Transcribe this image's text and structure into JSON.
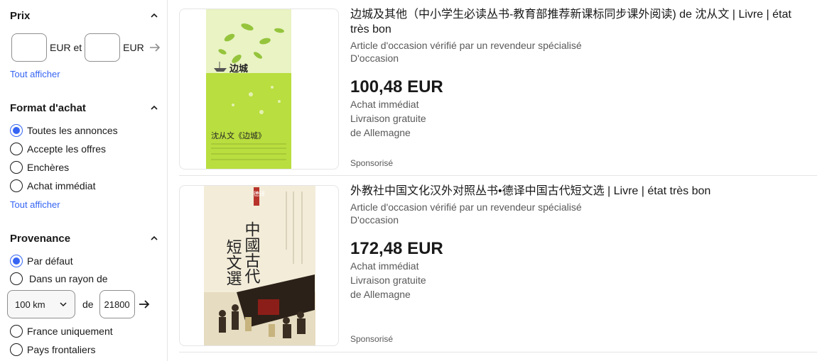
{
  "sidebar": {
    "price": {
      "title": "Prix",
      "currency_min": "EUR et",
      "currency_max": "EUR",
      "show_all": "Tout afficher"
    },
    "format": {
      "title": "Format d'achat",
      "options": [
        "Toutes les annonces",
        "Accepte les offres",
        "Enchères",
        "Achat immédiat"
      ],
      "selected_index": 0,
      "show_all": "Tout afficher"
    },
    "location": {
      "title": "Provenance",
      "options": [
        "Par défaut",
        "Dans un rayon de",
        "France uniquement",
        "Pays frontaliers"
      ],
      "selected_index": 0,
      "distance_value": "100 km",
      "de_label": "de",
      "zip_value": "21800"
    }
  },
  "listings": [
    {
      "title": "边城及其他（中小学生必读丛书-教育部推荐新课标同步课外阅读) de 沈从文 | Livre | état très bon",
      "subtitle": "Article d'occasion vérifié par un revendeur spécialisé",
      "condition": "D'occasion",
      "price": "100,48 EUR",
      "buy_format": "Achat immédiat",
      "shipping": "Livraison gratuite",
      "origin": "de Allemagne",
      "sponsored": "Sponsorisé",
      "cover_title": "边城",
      "cover_author": "沈从文《边城》"
    },
    {
      "title": "外教社中国文化汉外对照丛书•德译中国古代短文选 | Livre | état très bon",
      "subtitle": "Article d'occasion vérifié par un revendeur spécialisé",
      "condition": "D'occasion",
      "price": "172,48 EUR",
      "buy_format": "Achat immédiat",
      "shipping": "Livraison gratuite",
      "origin": "de Allemagne",
      "sponsored": "Sponsorisé",
      "cover_tag": "德译",
      "cover_title_1": "中國古代",
      "cover_title_2": "短文選"
    }
  ],
  "colors": {
    "accent": "#3665f3",
    "text": "#191919",
    "muted": "#595959",
    "border": "#e5e5e5"
  },
  "icons": [
    "chevron-up-icon",
    "arrow-right-icon",
    "chevron-down-icon"
  ]
}
